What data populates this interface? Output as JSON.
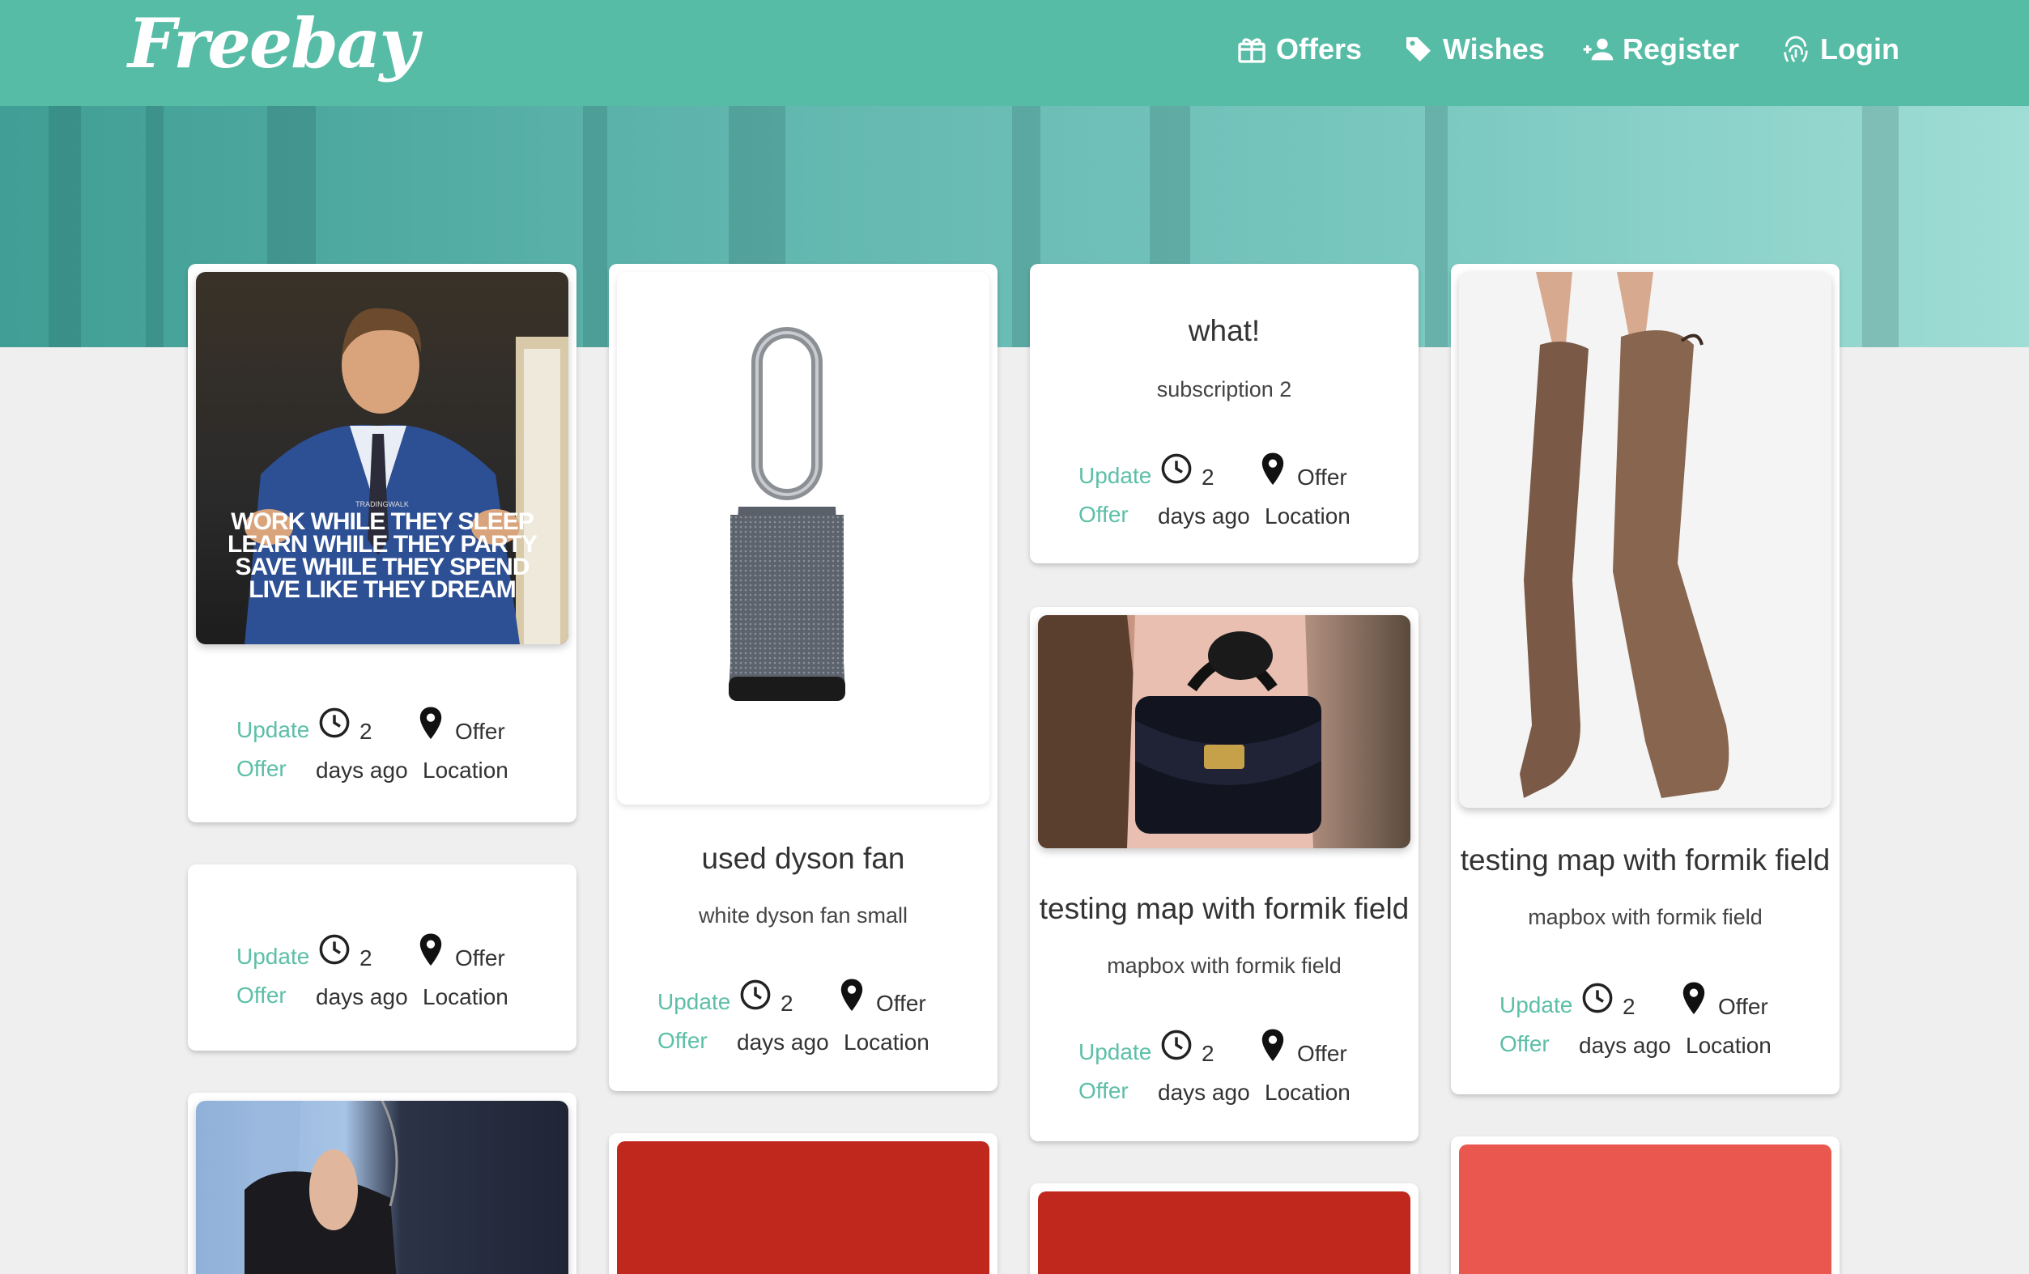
{
  "brand": {
    "logo_text": "Freebay"
  },
  "nav": {
    "items": [
      {
        "label": "Offers",
        "icon": "gift-icon"
      },
      {
        "label": "Wishes",
        "icon": "tag-icon"
      },
      {
        "label": "Register",
        "icon": "add-user-icon"
      },
      {
        "label": "Login",
        "icon": "fingerprint-icon"
      }
    ]
  },
  "card_meta": {
    "update_line1": "Update",
    "update_line2": "Offer",
    "time_number": "2",
    "time_rest": "days ago",
    "location_line1": "Offer",
    "location_line2": "Location"
  },
  "cards": {
    "wolf": {
      "image_caption": "WORK WHILE THEY SLEEP\nLEARN WHILE THEY PARTY\nSAVE WHILE THEY SPEND\nLIVE LIKE THEY DREAM",
      "image_watermark": "TRADINGWALK",
      "image_desc": "man-in-suit-motivational-poster"
    },
    "empty": {},
    "bag_woman": {
      "image_desc": "woman-with-handbag-photo"
    },
    "dyson": {
      "title": "used dyson fan",
      "subtitle": "white dyson fan small",
      "image_desc": "dyson-fan-photo"
    },
    "red1": {
      "color": "#c0281e"
    },
    "what": {
      "title": "what!",
      "subtitle": "subscription 2"
    },
    "bag": {
      "title": "testing map with formik field",
      "subtitle": "mapbox with formik field",
      "image_desc": "black-handbag-photo"
    },
    "red2": {
      "color": "#c0281e"
    },
    "boots": {
      "title": "testing map with formik field",
      "subtitle": "mapbox with formik field",
      "image_desc": "brown-boots-photo"
    },
    "red3": {
      "color": "#ea574e"
    }
  },
  "colors": {
    "brand": "#56bca6",
    "accent_link": "#5cbfa7"
  }
}
